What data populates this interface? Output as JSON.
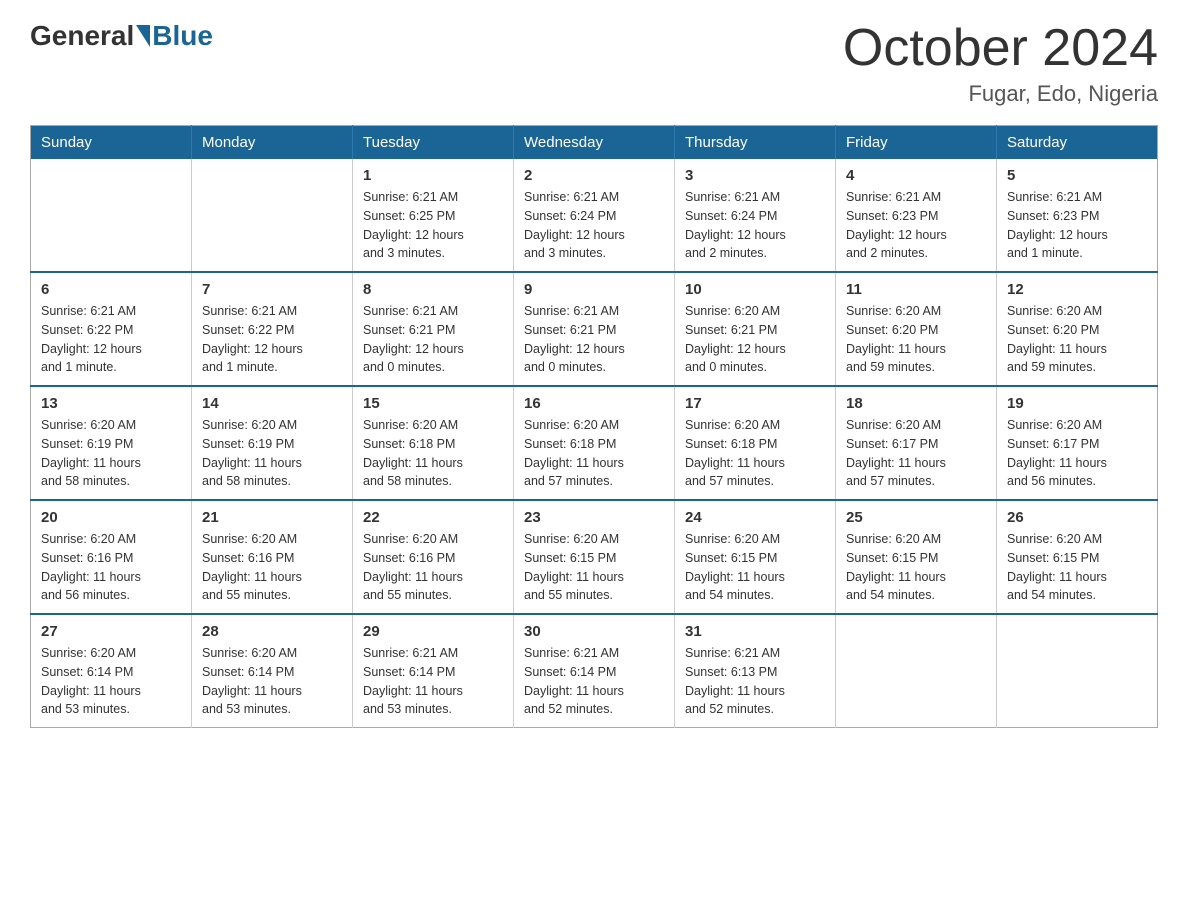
{
  "logo": {
    "general": "General",
    "blue": "Blue"
  },
  "title": "October 2024",
  "location": "Fugar, Edo, Nigeria",
  "days_of_week": [
    "Sunday",
    "Monday",
    "Tuesday",
    "Wednesday",
    "Thursday",
    "Friday",
    "Saturday"
  ],
  "weeks": [
    [
      {
        "day": "",
        "info": ""
      },
      {
        "day": "",
        "info": ""
      },
      {
        "day": "1",
        "info": "Sunrise: 6:21 AM\nSunset: 6:25 PM\nDaylight: 12 hours\nand 3 minutes."
      },
      {
        "day": "2",
        "info": "Sunrise: 6:21 AM\nSunset: 6:24 PM\nDaylight: 12 hours\nand 3 minutes."
      },
      {
        "day": "3",
        "info": "Sunrise: 6:21 AM\nSunset: 6:24 PM\nDaylight: 12 hours\nand 2 minutes."
      },
      {
        "day": "4",
        "info": "Sunrise: 6:21 AM\nSunset: 6:23 PM\nDaylight: 12 hours\nand 2 minutes."
      },
      {
        "day": "5",
        "info": "Sunrise: 6:21 AM\nSunset: 6:23 PM\nDaylight: 12 hours\nand 1 minute."
      }
    ],
    [
      {
        "day": "6",
        "info": "Sunrise: 6:21 AM\nSunset: 6:22 PM\nDaylight: 12 hours\nand 1 minute."
      },
      {
        "day": "7",
        "info": "Sunrise: 6:21 AM\nSunset: 6:22 PM\nDaylight: 12 hours\nand 1 minute."
      },
      {
        "day": "8",
        "info": "Sunrise: 6:21 AM\nSunset: 6:21 PM\nDaylight: 12 hours\nand 0 minutes."
      },
      {
        "day": "9",
        "info": "Sunrise: 6:21 AM\nSunset: 6:21 PM\nDaylight: 12 hours\nand 0 minutes."
      },
      {
        "day": "10",
        "info": "Sunrise: 6:20 AM\nSunset: 6:21 PM\nDaylight: 12 hours\nand 0 minutes."
      },
      {
        "day": "11",
        "info": "Sunrise: 6:20 AM\nSunset: 6:20 PM\nDaylight: 11 hours\nand 59 minutes."
      },
      {
        "day": "12",
        "info": "Sunrise: 6:20 AM\nSunset: 6:20 PM\nDaylight: 11 hours\nand 59 minutes."
      }
    ],
    [
      {
        "day": "13",
        "info": "Sunrise: 6:20 AM\nSunset: 6:19 PM\nDaylight: 11 hours\nand 58 minutes."
      },
      {
        "day": "14",
        "info": "Sunrise: 6:20 AM\nSunset: 6:19 PM\nDaylight: 11 hours\nand 58 minutes."
      },
      {
        "day": "15",
        "info": "Sunrise: 6:20 AM\nSunset: 6:18 PM\nDaylight: 11 hours\nand 58 minutes."
      },
      {
        "day": "16",
        "info": "Sunrise: 6:20 AM\nSunset: 6:18 PM\nDaylight: 11 hours\nand 57 minutes."
      },
      {
        "day": "17",
        "info": "Sunrise: 6:20 AM\nSunset: 6:18 PM\nDaylight: 11 hours\nand 57 minutes."
      },
      {
        "day": "18",
        "info": "Sunrise: 6:20 AM\nSunset: 6:17 PM\nDaylight: 11 hours\nand 57 minutes."
      },
      {
        "day": "19",
        "info": "Sunrise: 6:20 AM\nSunset: 6:17 PM\nDaylight: 11 hours\nand 56 minutes."
      }
    ],
    [
      {
        "day": "20",
        "info": "Sunrise: 6:20 AM\nSunset: 6:16 PM\nDaylight: 11 hours\nand 56 minutes."
      },
      {
        "day": "21",
        "info": "Sunrise: 6:20 AM\nSunset: 6:16 PM\nDaylight: 11 hours\nand 55 minutes."
      },
      {
        "day": "22",
        "info": "Sunrise: 6:20 AM\nSunset: 6:16 PM\nDaylight: 11 hours\nand 55 minutes."
      },
      {
        "day": "23",
        "info": "Sunrise: 6:20 AM\nSunset: 6:15 PM\nDaylight: 11 hours\nand 55 minutes."
      },
      {
        "day": "24",
        "info": "Sunrise: 6:20 AM\nSunset: 6:15 PM\nDaylight: 11 hours\nand 54 minutes."
      },
      {
        "day": "25",
        "info": "Sunrise: 6:20 AM\nSunset: 6:15 PM\nDaylight: 11 hours\nand 54 minutes."
      },
      {
        "day": "26",
        "info": "Sunrise: 6:20 AM\nSunset: 6:15 PM\nDaylight: 11 hours\nand 54 minutes."
      }
    ],
    [
      {
        "day": "27",
        "info": "Sunrise: 6:20 AM\nSunset: 6:14 PM\nDaylight: 11 hours\nand 53 minutes."
      },
      {
        "day": "28",
        "info": "Sunrise: 6:20 AM\nSunset: 6:14 PM\nDaylight: 11 hours\nand 53 minutes."
      },
      {
        "day": "29",
        "info": "Sunrise: 6:21 AM\nSunset: 6:14 PM\nDaylight: 11 hours\nand 53 minutes."
      },
      {
        "day": "30",
        "info": "Sunrise: 6:21 AM\nSunset: 6:14 PM\nDaylight: 11 hours\nand 52 minutes."
      },
      {
        "day": "31",
        "info": "Sunrise: 6:21 AM\nSunset: 6:13 PM\nDaylight: 11 hours\nand 52 minutes."
      },
      {
        "day": "",
        "info": ""
      },
      {
        "day": "",
        "info": ""
      }
    ]
  ]
}
